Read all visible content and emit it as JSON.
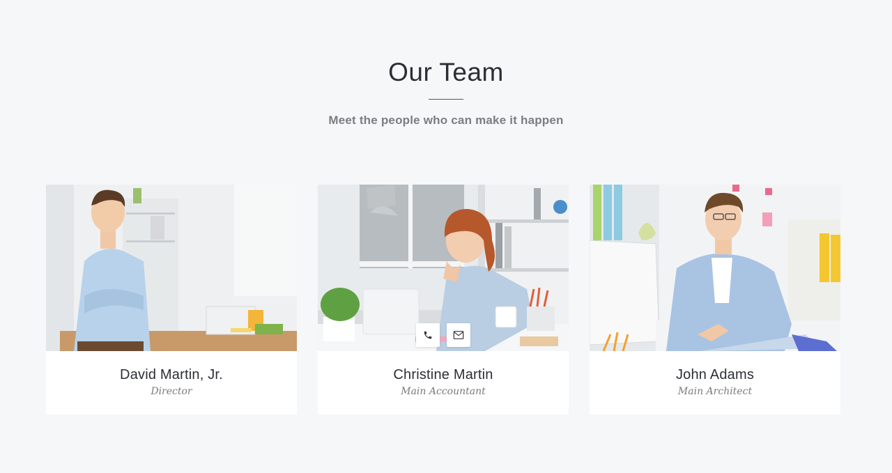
{
  "section": {
    "title": "Our Team",
    "subtitle": "Meet the people who can make it happen"
  },
  "members": [
    {
      "name": "David Martin, Jr.",
      "role": "Director"
    },
    {
      "name": "Christine Martin",
      "role": "Main Accountant"
    },
    {
      "name": "John Adams",
      "role": "Main Architect"
    }
  ],
  "icons": {
    "phone": "phone-icon",
    "email": "envelope-icon"
  },
  "colors": {
    "background": "#f6f7f9",
    "card": "#ffffff",
    "title": "#2b2e34",
    "muted": "#7b7d80"
  }
}
